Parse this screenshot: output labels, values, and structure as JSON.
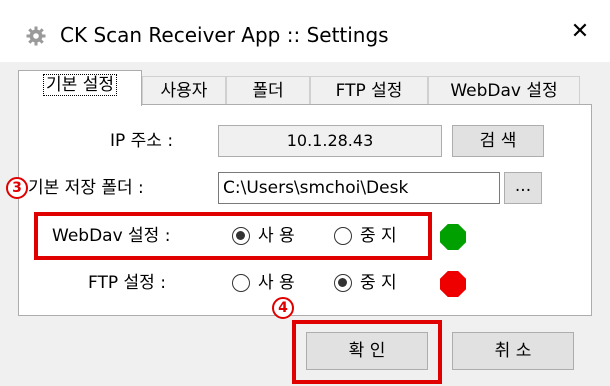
{
  "window": {
    "title": "CK Scan Receiver App :: Settings",
    "close_symbol": "✕"
  },
  "tabs": [
    {
      "label": "기본 설정",
      "active": true
    },
    {
      "label": "사용자",
      "active": false
    },
    {
      "label": "폴더",
      "active": false
    },
    {
      "label": "FTP 설정",
      "active": false
    },
    {
      "label": "WebDav 설정",
      "active": false
    }
  ],
  "form": {
    "ip_label": "IP 주소 :",
    "ip_value": "10.1.28.43",
    "search_button": "검 색",
    "storage_label": "기본 저장 폴더 :",
    "storage_path": "C:\\Users\\smchoi\\Desk",
    "browse_button": "...",
    "webdav": {
      "label": "WebDav 설정 :",
      "option_use": "사 용",
      "option_stop": "중 지",
      "selected": "use",
      "status_color": "#00a000"
    },
    "ftp": {
      "label": "FTP 설정 :",
      "option_use": "사 용",
      "option_stop": "중 지",
      "selected": "stop",
      "status_color": "#ee0000"
    }
  },
  "buttons": {
    "ok": "확 인",
    "cancel": "취 소"
  },
  "annotations": {
    "marker_3": "3",
    "marker_4": "4",
    "color": "#e00000"
  }
}
